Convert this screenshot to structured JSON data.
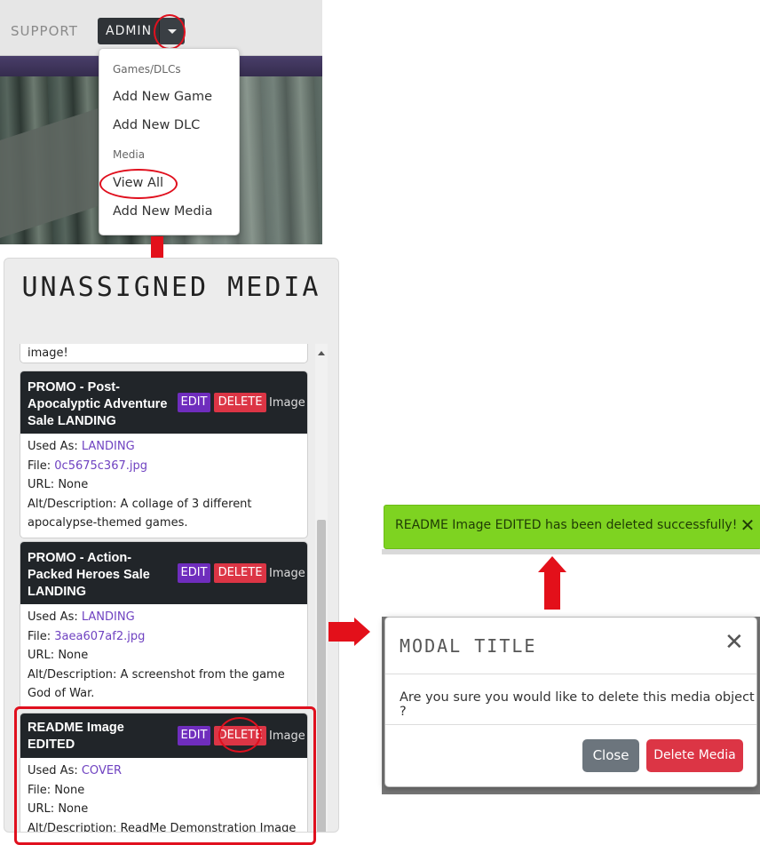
{
  "navbar": {
    "support_label": "SUPPORT",
    "admin_label": "ADMIN"
  },
  "dropdown": {
    "items": [
      {
        "type": "header",
        "label": "Games/DLCs"
      },
      {
        "type": "item",
        "label": "Add New Game"
      },
      {
        "type": "item",
        "label": "Add New DLC"
      },
      {
        "type": "header",
        "label": "Media"
      },
      {
        "type": "item",
        "label": "View All"
      },
      {
        "type": "item",
        "label": "Add New Media"
      }
    ]
  },
  "media_panel": {
    "title": "UNASSIGNED MEDIA",
    "previous_card_text": "image!",
    "cards": [
      {
        "title": "PROMO - Post-Apocalyptic Adventure Sale LANDING",
        "edit_label": "EDIT",
        "delete_label": "DELETE",
        "type": "Image",
        "used_as_label": "Used As:",
        "used_as": "LANDING",
        "file_label": "File:",
        "file": "0c5675c367.jpg",
        "url_label": "URL:",
        "url": "None",
        "alt_label": "Alt/Description:",
        "alt": "A collage of 3 different apocalypse-themed games."
      },
      {
        "title": "PROMO - Action-Packed Heroes Sale LANDING",
        "edit_label": "EDIT",
        "delete_label": "DELETE",
        "type": "Image",
        "used_as_label": "Used As:",
        "used_as": "LANDING",
        "file_label": "File:",
        "file": "3aea607af2.jpg",
        "url_label": "URL:",
        "url": "None",
        "alt_label": "Alt/Description:",
        "alt": "A screenshot from the game God of War."
      },
      {
        "title": "README Image EDITED",
        "edit_label": "EDIT",
        "delete_label": "DELETE",
        "type": "Image",
        "used_as_label": "Used As:",
        "used_as": "COVER",
        "file_label": "File:",
        "file": "None",
        "url_label": "URL:",
        "url": "None",
        "alt_label": "Alt/Description:",
        "alt": "ReadMe Demonstration Image"
      }
    ]
  },
  "alert": {
    "message": "README Image EDITED has been deleted successfully!",
    "close_symbol": "✕"
  },
  "modal": {
    "title": "MODAL TITLE",
    "close_symbol": "✕",
    "body": "Are you sure you would like to delete this media object ?",
    "close_button": "Close",
    "delete_button": "Delete Media"
  },
  "colors": {
    "annotation_red": "#e0101e",
    "edit_purple": "#6f2dbd",
    "delete_red": "#dc3545",
    "success_green": "#7ed321"
  }
}
